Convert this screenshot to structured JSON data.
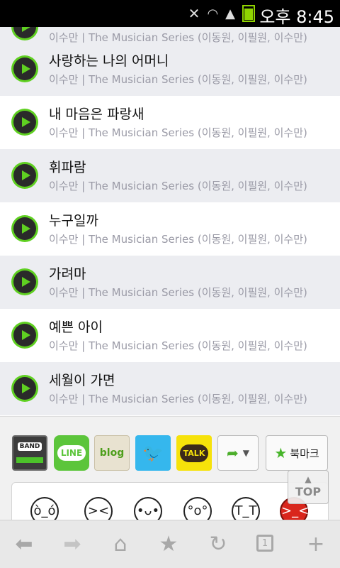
{
  "status_bar": {
    "time": "오후 8:45",
    "battery_color": "#8fd400"
  },
  "tracks": [
    {
      "title": "",
      "subtitle": "이수만 | The Musician Series (이동원, 이필원, 이수만)"
    },
    {
      "title": "사랑하는 나의 어머니",
      "subtitle": "이수만 | The Musician Series (이동원, 이필원, 이수만)"
    },
    {
      "title": "내 마음은 파랑새",
      "subtitle": "이수만 | The Musician Series (이동원, 이필원, 이수만)"
    },
    {
      "title": "휘파람",
      "subtitle": "이수만 | The Musician Series (이동원, 이필원, 이수만)"
    },
    {
      "title": "누구일까",
      "subtitle": "이수만 | The Musician Series (이동원, 이필원, 이수만)"
    },
    {
      "title": "가려마",
      "subtitle": "이수만 | The Musician Series (이동원, 이필원, 이수만)"
    },
    {
      "title": "예쁜 아이",
      "subtitle": "이수만 | The Musician Series (이동원, 이필원, 이수만)"
    },
    {
      "title": "세월이 가면",
      "subtitle": "이수만 | The Musician Series (이동원, 이필원, 이수만)"
    }
  ],
  "share": {
    "band_label": "BAND",
    "line_label": "LINE",
    "blog_label": "blog",
    "talk_label": "TALK",
    "bookmark_label": "북마크"
  },
  "top_button": {
    "label": "TOP"
  },
  "browser_nav": {
    "tab_count": "1"
  },
  "colors": {
    "accent_green": "#5fd021",
    "row_shade": "#ecedf1",
    "subtitle_gray": "#9a9aa6"
  }
}
